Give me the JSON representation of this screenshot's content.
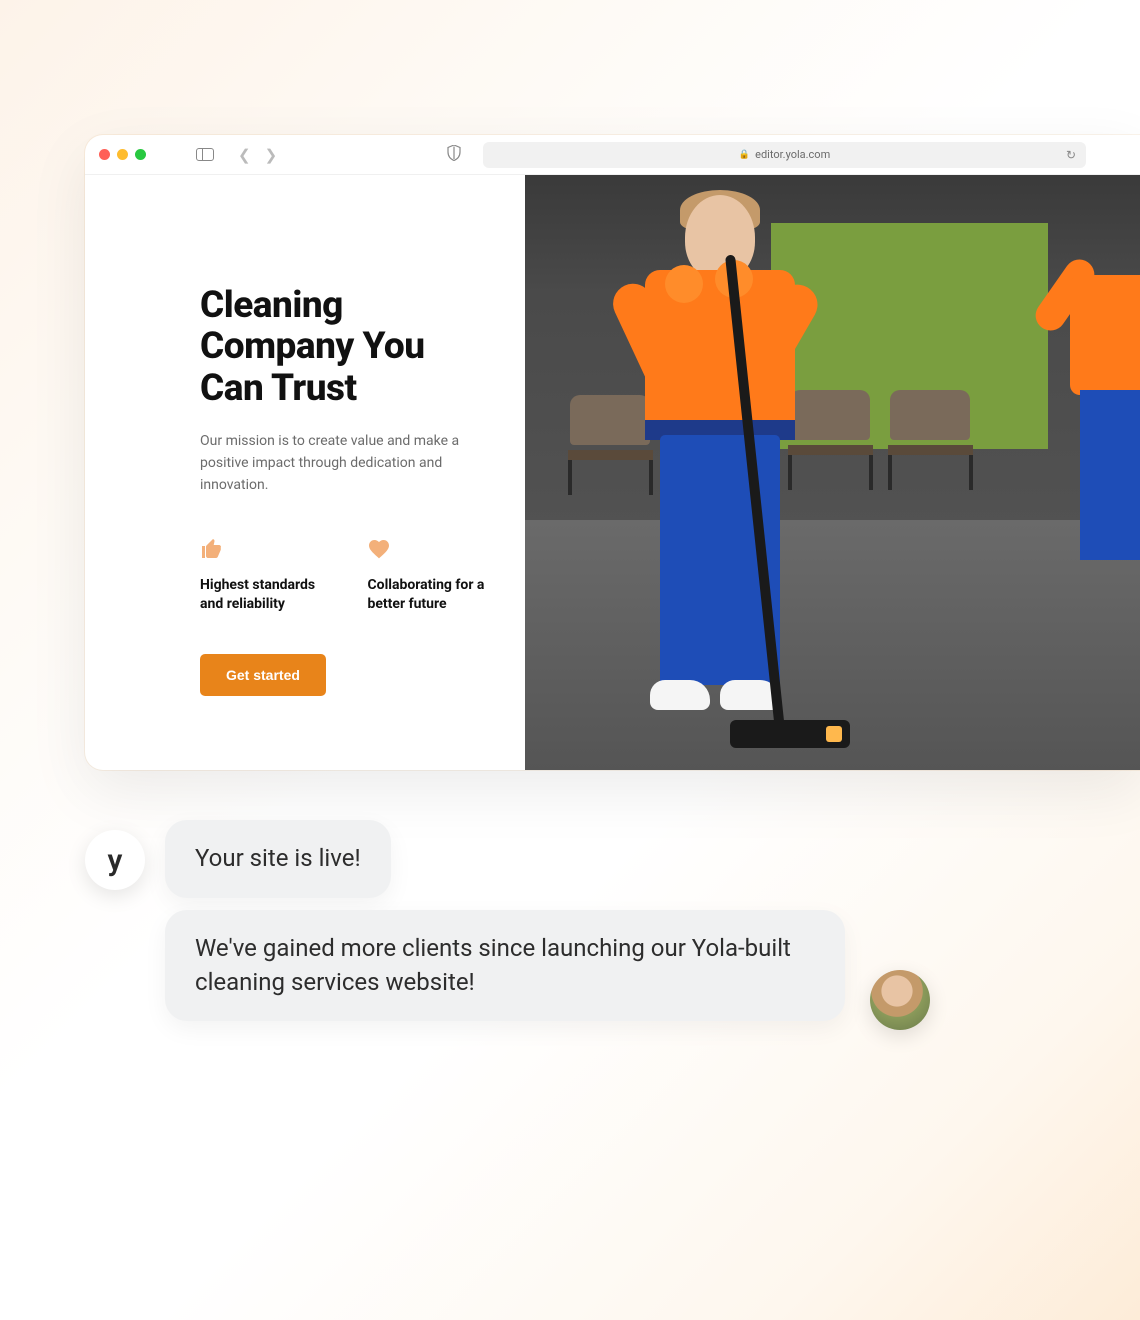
{
  "browser": {
    "url": "editor.yola.com"
  },
  "hero": {
    "title": "Cleaning Company You Can Trust",
    "subtitle": "Our mission is to create value and make a positive impact through dedication and innovation.",
    "features": [
      {
        "label": "Highest standards and reliability"
      },
      {
        "label": "Collaborating for a better future"
      }
    ],
    "cta_label": "Get started"
  },
  "chat": {
    "brand_letter": "y",
    "bubble_1": "Your site is live!",
    "bubble_2": "We've gained more clients since launching our Yola-built cleaning services website!"
  },
  "colors": {
    "accent": "#e8841a",
    "accent_light": "#f3b07a"
  }
}
